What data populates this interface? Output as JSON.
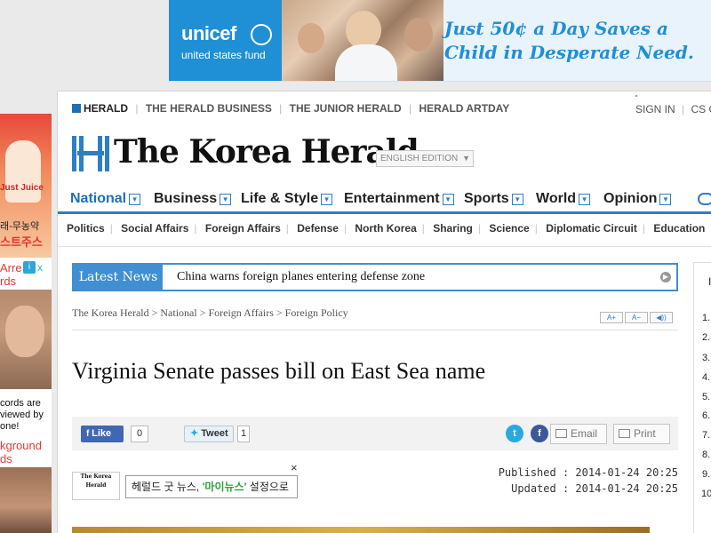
{
  "top_ad": {
    "brand": "unicef",
    "sub": "united states fund",
    "slogan_1": "Just 50¢ a Day Saves a",
    "slogan_2": "Child in Desperate Need."
  },
  "left_ad": {
    "juice": "Just Juice",
    "korean_1": "래-무농약",
    "korean_2": "스트주스",
    "arrests_1": "Arre",
    "arrests_2": "rds",
    "ad_badge": "i",
    "ad_close": "x",
    "records_1": "cords are",
    "records_2": "viewed by",
    "records_3": "one!",
    "background_1": "kground",
    "background_2": "ds"
  },
  "top_nav": {
    "herald": "HERALD",
    "links": [
      "THE HERALD BUSINESS",
      "THE JUNIOR HERALD",
      "HERALD ARTDAY"
    ],
    "sign_in": "SIGN IN",
    "cs": "CS C"
  },
  "brand": {
    "name": "The Korea Herald",
    "edition": "ENGLISH EDITION"
  },
  "main_nav": {
    "items": [
      "National",
      "Business",
      "Life & Style",
      "Entertainment",
      "Sports",
      "World",
      "Opinion"
    ]
  },
  "sub_nav": {
    "items": [
      "Politics",
      "Social Affairs",
      "Foreign Affairs",
      "Defense",
      "North Korea",
      "Sharing",
      "Science",
      "Diplomatic Circuit",
      "Education"
    ]
  },
  "latest_news": {
    "label": "Latest News",
    "headline": "China warns foreign planes entering defense zone"
  },
  "breadcrumb": "The Korea Herald > National > Foreign Affairs > Foreign Policy",
  "font_buttons": [
    "A+",
    "A−",
    "◀))"
  ],
  "article": {
    "title": "Virginia Senate passes bill on East Sea name",
    "published": "Published : 2014-01-24 20:25",
    "updated": "Updated : 2014-01-24 20:25"
  },
  "share": {
    "like": "Like",
    "like_count": "0",
    "tweet": "Tweet",
    "tweet_count": "1",
    "email": "Email",
    "print": "Print",
    "colors": {
      "twitter": "#2aa9e0",
      "facebook": "#3b5998",
      "me2day": "#7b4fbf",
      "yozm": "#e53935"
    }
  },
  "promo": {
    "thumb": "The Korea Herald",
    "text_pre": "헤럴드 굿 뉴스, ",
    "text_hl": "'마이뉴스'",
    "text_post": " 설정으로",
    "close": "×"
  },
  "sidebar": {
    "first": "I",
    "numbers": [
      "1.",
      "2.",
      "3.",
      "4.",
      "5.",
      "6.",
      "7.",
      "8.",
      "9.",
      "10."
    ]
  },
  "colors": {
    "accent": "#2d7ec7",
    "unicef_blue": "#1f8fd6"
  }
}
